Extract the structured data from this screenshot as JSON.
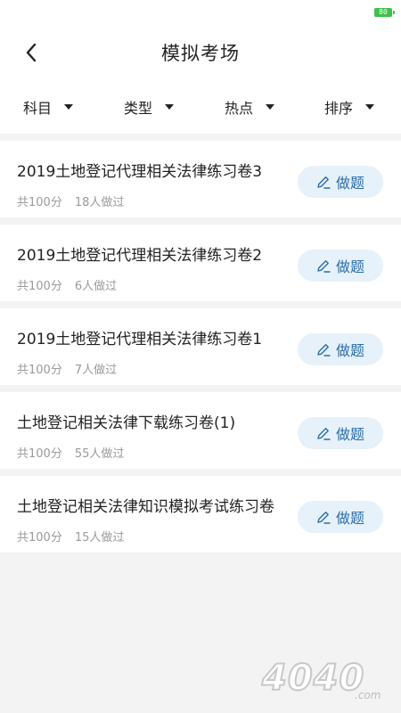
{
  "status_bar": {
    "battery": "80"
  },
  "header": {
    "title": "模拟考场",
    "back_icon": "chevron-left-icon"
  },
  "filters": [
    {
      "label": "科目"
    },
    {
      "label": "类型"
    },
    {
      "label": "热点"
    },
    {
      "label": "排序"
    }
  ],
  "exams": [
    {
      "title": "2019土地登记代理相关法律练习卷3",
      "score": "共100分",
      "count": "18人做过",
      "action": "做题"
    },
    {
      "title": "2019土地登记代理相关法律练习卷2",
      "score": "共100分",
      "count": "6人做过",
      "action": "做题"
    },
    {
      "title": "2019土地登记代理相关法律练习卷1",
      "score": "共100分",
      "count": "7人做过",
      "action": "做题"
    },
    {
      "title": "土地登记相关法律下载练习卷(1)",
      "score": "共100分",
      "count": "55人做过",
      "action": "做题"
    },
    {
      "title": "土地登记相关法律知识模拟考试练习卷",
      "score": "共100分",
      "count": "15人做过",
      "action": "做题"
    }
  ],
  "watermark": {
    "text": "4040",
    "suffix": ".com"
  },
  "colors": {
    "accent": "#2c6ea8",
    "button_bg": "#e6f1fa",
    "meta_text": "#9a9a9a",
    "battery": "#3cc24a"
  }
}
